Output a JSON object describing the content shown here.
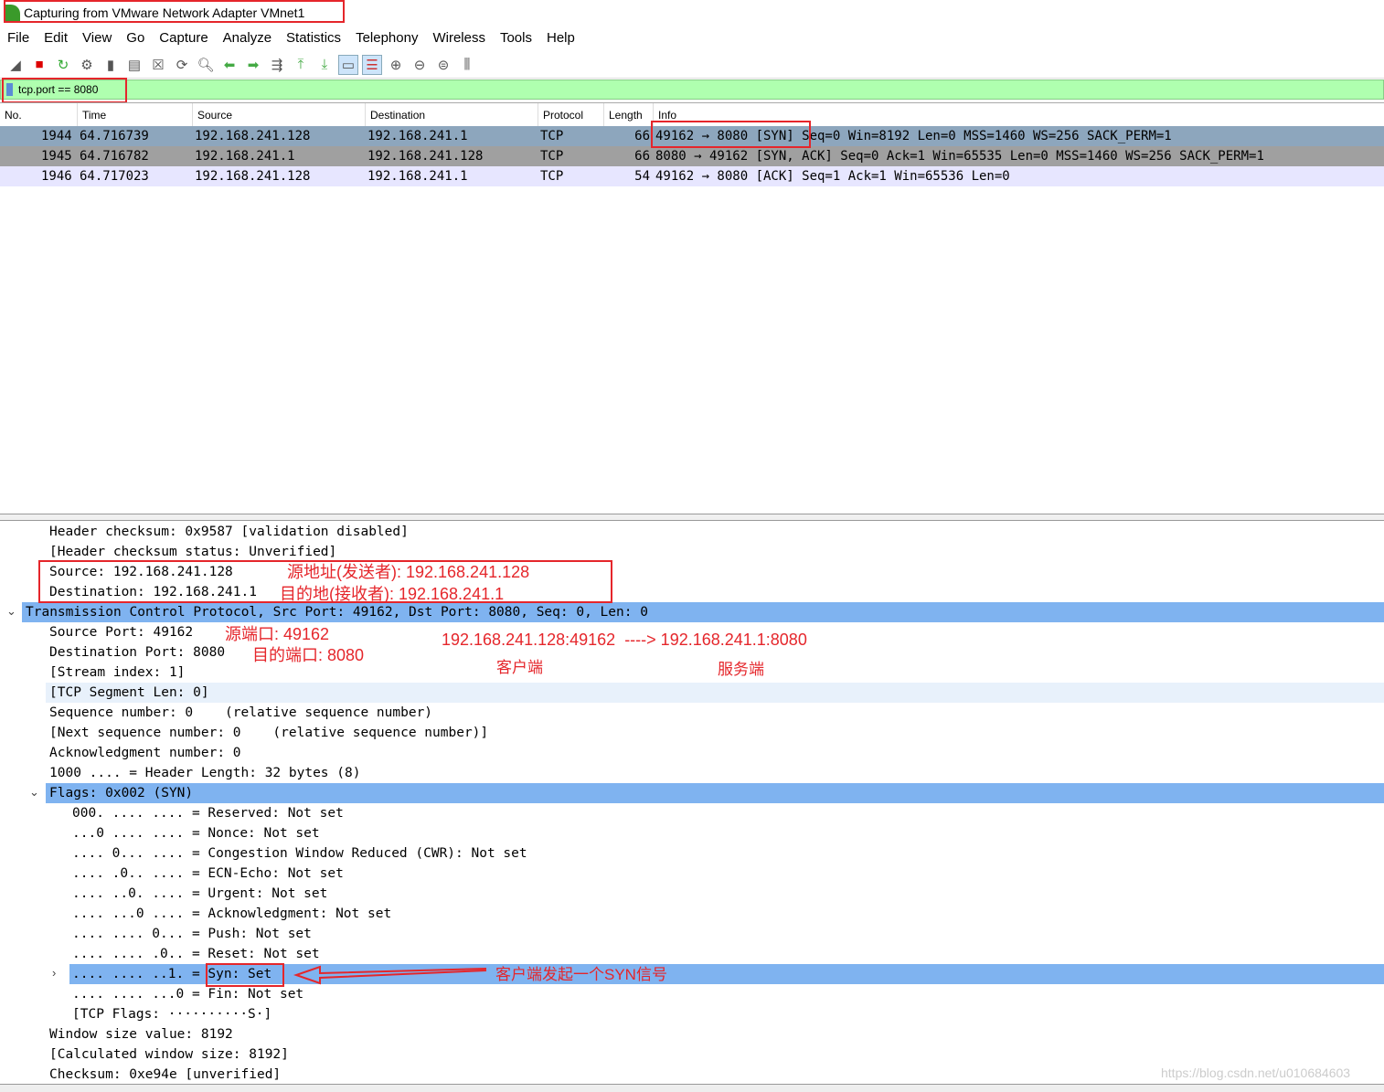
{
  "window": {
    "title": "Capturing from VMware Network Adapter VMnet1"
  },
  "menu": [
    "File",
    "Edit",
    "View",
    "Go",
    "Capture",
    "Analyze",
    "Statistics",
    "Telephony",
    "Wireless",
    "Tools",
    "Help"
  ],
  "toolbar": [
    "shark-fin-icon",
    "stop-icon",
    "restart-icon",
    "options-icon",
    "open-icon",
    "save-icon",
    "close-file-icon",
    "reload-icon",
    "find-icon",
    "back-icon",
    "forward-icon",
    "go-to-packet-icon",
    "first-packet-icon",
    "last-packet-icon",
    "autoscroll-icon",
    "colorize-icon",
    "zoom-in-icon",
    "zoom-out-icon",
    "zoom-normal-icon",
    "resize-columns-icon"
  ],
  "filter": {
    "value": "tcp.port == 8080"
  },
  "columns": [
    "No.",
    "Time",
    "Source",
    "Destination",
    "Protocol",
    "Length",
    "Info"
  ],
  "packets": [
    {
      "no": "1944",
      "time": "64.716739",
      "src": "192.168.241.128",
      "dst": "192.168.241.1",
      "proto": "TCP",
      "len": "66",
      "info": "49162 → 8080 [SYN] Seq=0 Win=8192 Len=0 MSS=1460 WS=256 SACK_PERM=1"
    },
    {
      "no": "1945",
      "time": "64.716782",
      "src": "192.168.241.1",
      "dst": "192.168.241.128",
      "proto": "TCP",
      "len": "66",
      "info": "8080 → 49162 [SYN, ACK] Seq=0 Ack=1 Win=65535 Len=0 MSS=1460 WS=256 SACK_PERM=1"
    },
    {
      "no": "1946",
      "time": "64.717023",
      "src": "192.168.241.128",
      "dst": "192.168.241.1",
      "proto": "TCP",
      "len": "54",
      "info": "49162 → 8080 [ACK] Seq=1 Ack=1 Win=65536 Len=0"
    }
  ],
  "details": [
    "Header checksum: 0x9587 [validation disabled]",
    "[Header checksum status: Unverified]",
    "Source: 192.168.241.128",
    "Destination: 192.168.241.1",
    "Transmission Control Protocol, Src Port: 49162, Dst Port: 8080, Seq: 0, Len: 0",
    "Source Port: 49162",
    "Destination Port: 8080",
    "[Stream index: 1]",
    "[TCP Segment Len: 0]",
    "Sequence number: 0    (relative sequence number)",
    "[Next sequence number: 0    (relative sequence number)]",
    "Acknowledgment number: 0",
    "1000 .... = Header Length: 32 bytes (8)",
    "Flags: 0x002 (SYN)",
    "000. .... .... = Reserved: Not set",
    "...0 .... .... = Nonce: Not set",
    ".... 0... .... = Congestion Window Reduced (CWR): Not set",
    ".... .0.. .... = ECN-Echo: Not set",
    ".... ..0. .... = Urgent: Not set",
    ".... ...0 .... = Acknowledgment: Not set",
    ".... .... 0... = Push: Not set",
    ".... .... .0.. = Reset: Not set",
    ".... .... ..1. = Syn: Set",
    ".... .... ...0 = Fin: Not set",
    "[TCP Flags: ··········S·]",
    "Window size value: 8192",
    "[Calculated window size: 8192]",
    "Checksum: 0xe94e [unverified]"
  ],
  "annotations": {
    "src": "源地址(发送者): 192.168.241.128",
    "dst": "目的地(接收者): 192.168.241.1",
    "srcport": "源端口: 49162",
    "dstport": "目的端口: 8080",
    "flow": "192.168.241.128:49162  ----> 192.168.241.1:8080",
    "client": "客户端",
    "server": "服务端",
    "syn": "客户端发起一个SYN信号"
  },
  "watermark": "https://blog.csdn.net/u010684603",
  "colors": {
    "annotation": "#e5262b",
    "selected": "#7fb3f0",
    "filter_ok": "#afffaf"
  }
}
